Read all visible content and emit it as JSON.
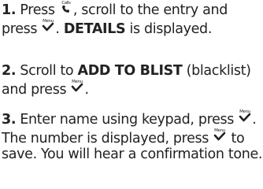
{
  "step1": {
    "number": "1.",
    "text_a": " Press ",
    "icon_calls_name": "calls-icon",
    "icon_calls_label": "Calls",
    "text_b": ", scroll to the entry and press ",
    "icon_menu_label": "Menu",
    "text_c": ". ",
    "bold": "DETAILS",
    "text_d": " is displayed."
  },
  "step2": {
    "number": "2.",
    "text_a": " Scroll to ",
    "bold": "ADD TO BLIST",
    "text_b": " (blacklist) and press ",
    "icon_menu_label": "Menu",
    "text_c": "."
  },
  "step3": {
    "number": "3.",
    "text_a": " Enter name using keypad, press ",
    "icon_menu_label": "Menu",
    "text_b": ". The number is displayed, press ",
    "icon_menu_label_2": "Menu",
    "text_c": " to save. You will hear a confirmation tone."
  }
}
